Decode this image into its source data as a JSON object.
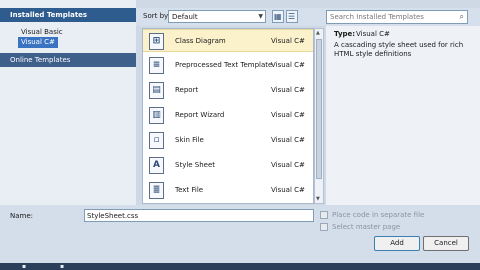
{
  "left_panel": {
    "header": "Installed Templates",
    "items": [
      "Visual Basic",
      "Visual C#"
    ],
    "selected": "Visual C#",
    "online": "Online Templates"
  },
  "toolbar": {
    "sort_label": "Sort by:",
    "sort_value": "Default",
    "search_placeholder": "Search Installed Templates"
  },
  "templates": [
    {
      "name": "Class Diagram",
      "type": "Visual C#",
      "selected": true
    },
    {
      "name": "Preprocessed Text Template",
      "type": "Visual C#"
    },
    {
      "name": "Report",
      "type": "Visual C#"
    },
    {
      "name": "Report Wizard",
      "type": "Visual C#"
    },
    {
      "name": "Skin File",
      "type": "Visual C#"
    },
    {
      "name": "Style Sheet",
      "type": "Visual C#"
    },
    {
      "name": "Text File",
      "type": "Visual C#"
    }
  ],
  "details": {
    "type_label": "Type:",
    "type_value": "Visual C#",
    "description": "A cascading style sheet used for rich HTML style definitions"
  },
  "bottom": {
    "name_label": "Name:",
    "name_value": "StyleSheet.css",
    "place_code_label": "Place code in separate file",
    "master_page_label": "Select master page",
    "add_label": "Add",
    "cancel_label": "Cancel"
  },
  "colors": {
    "header": "#2f5c8f",
    "selection": "#3a73c2",
    "row_highlight": "#fbf2cc"
  }
}
